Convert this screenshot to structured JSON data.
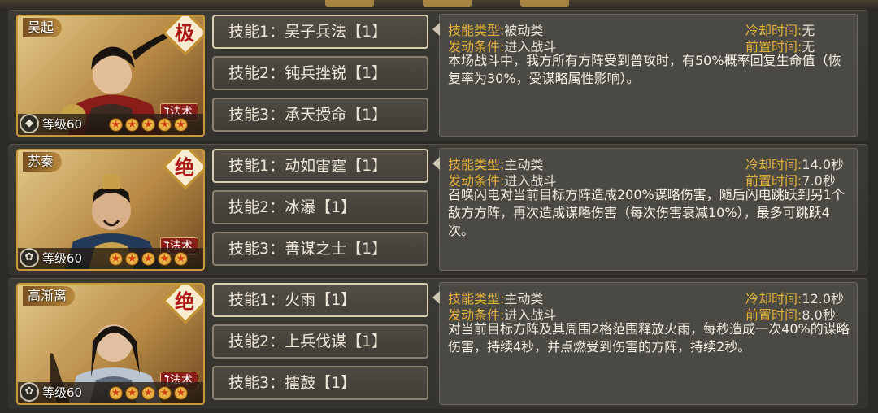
{
  "labels": {
    "type": "技能类型:",
    "trigger": "发动条件:",
    "cooldown": "冷却时间:",
    "prep": "前置时间:"
  },
  "heroes": [
    {
      "name": "吴起",
      "rank": "极",
      "school": "法术",
      "level": "等级60",
      "stars": 5,
      "skills": [
        "技能1：吴子兵法【1】",
        "技能2：钝兵挫锐【1】",
        "技能3：承天授命【1】"
      ],
      "detail": {
        "type": "被动类",
        "trigger": "进入战斗",
        "cooldown": "无",
        "prep": "无",
        "description": "本场战斗中，我方所有方阵受到普攻时，有50%概率回复生命值（恢复率为30%，受谋略属性影响）。"
      }
    },
    {
      "name": "苏秦",
      "rank": "绝",
      "school": "法术",
      "level": "等级60",
      "stars": 5,
      "skills": [
        "技能1：动如雷霆【1】",
        "技能2：冰瀑【1】",
        "技能3：善谋之士【1】"
      ],
      "detail": {
        "type": "主动类",
        "trigger": "进入战斗",
        "cooldown": "14.0秒",
        "prep": "7.0秒",
        "description": "召唤闪电对当前目标方阵造成200%谋略伤害，随后闪电跳跃到另1个敌方方阵，再次造成谋略伤害（每次伤害衰减10%），最多可跳跃4次。"
      }
    },
    {
      "name": "高渐离",
      "rank": "绝",
      "school": "法术",
      "level": "等级60",
      "stars": 5,
      "skills": [
        "技能1：火雨【1】",
        "技能2：上兵伐谋【1】",
        "技能3：擂鼓【1】"
      ],
      "detail": {
        "type": "主动类",
        "trigger": "进入战斗",
        "cooldown": "12.0秒",
        "prep": "8.0秒",
        "description": "对当前目标方阵及其周围2格范围释放火雨，每秒造成一次40%的谋略伤害，持续4秒，并点燃受到伤害的方阵，持续2秒。"
      }
    }
  ],
  "icons": {
    "school": "staff-icon",
    "level_emblems": [
      "shield-icon",
      "lotus-icon",
      "lotus-icon"
    ],
    "star": "star-icon"
  }
}
